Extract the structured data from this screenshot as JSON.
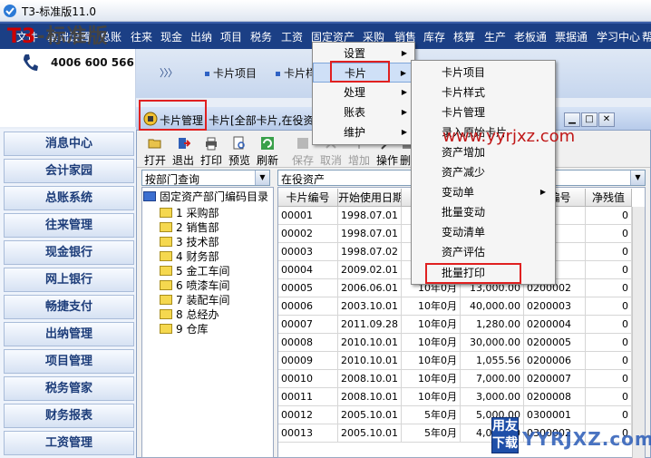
{
  "app": {
    "title": "T3-标准版11.0"
  },
  "menubar": {
    "items": [
      "文件",
      "基础设置",
      "总账",
      "往来",
      "现金",
      "出纳",
      "项目",
      "税务",
      "工资",
      "固定资产",
      "采购",
      "销售",
      "库存",
      "核算",
      "生产",
      "老板通",
      "票据通",
      "学习中心",
      "帮"
    ]
  },
  "logo": {
    "t3": "T3",
    "rest": "-标准版",
    "phone": "4006 600 566"
  },
  "sidebar": {
    "items": [
      "消息中心",
      "会计家园",
      "总账系统",
      "往来管理",
      "现金银行",
      "网上银行",
      "畅捷支付",
      "出纳管理",
      "项目管理",
      "税务管家",
      "财务报表",
      "工资管理"
    ]
  },
  "tabs": {
    "arrows": "〉〉〉",
    "items": [
      "卡片项目",
      "卡片样式"
    ]
  },
  "child": {
    "title": "卡片管理",
    "subtitle": "卡片[全部卡片,在役资产]"
  },
  "toolbar": {
    "items": [
      "打开",
      "退出",
      "打印",
      "预览",
      "刷新",
      "保存",
      "取消",
      "增加",
      "操作",
      "删"
    ]
  },
  "left_combo": {
    "value": "按部门查询"
  },
  "right_combo": {
    "value": "在役资产"
  },
  "tree": {
    "root": "固定资产部门编码目录",
    "items": [
      "1 采购部",
      "2 销售部",
      "3 技术部",
      "4 财务部",
      "5 金工车间",
      "6 喷漆车间",
      "7 装配车间",
      "8 总经办",
      "9 仓库"
    ]
  },
  "grid": {
    "headers": [
      "卡片编号",
      "开始使用日期",
      "",
      "",
      "产编号",
      "净残值"
    ],
    "rows": [
      [
        "00001",
        "1998.07.01",
        "",
        "",
        "01",
        "0"
      ],
      [
        "00002",
        "1998.07.01",
        "",
        "",
        "02",
        "0"
      ],
      [
        "00003",
        "1998.07.02",
        "",
        "",
        "03",
        "0"
      ],
      [
        "00004",
        "2009.02.01",
        "",
        "",
        "01",
        "0"
      ],
      [
        "00005",
        "2006.06.01",
        "10年0月",
        "13,000.00",
        "0200002",
        "0"
      ],
      [
        "00006",
        "2003.10.01",
        "10年0月",
        "40,000.00",
        "0200003",
        "0"
      ],
      [
        "00007",
        "2011.09.28",
        "10年0月",
        "1,280.00",
        "0200004",
        "0"
      ],
      [
        "00008",
        "2010.10.01",
        "10年0月",
        "30,000.00",
        "0200005",
        "0"
      ],
      [
        "00009",
        "2010.10.01",
        "10年0月",
        "1,055.56",
        "0200006",
        "0"
      ],
      [
        "00010",
        "2008.10.01",
        "10年0月",
        "7,000.00",
        "0200007",
        "0"
      ],
      [
        "00011",
        "2008.10.01",
        "10年0月",
        "3,000.00",
        "0200008",
        "0"
      ],
      [
        "00012",
        "2005.10.01",
        "5年0月",
        "5,000.00",
        "0300001",
        "0"
      ],
      [
        "00013",
        "2005.10.01",
        "5年0月",
        "4,000.00",
        "0300002",
        "0"
      ]
    ]
  },
  "menu_fixed_assets": {
    "items": [
      "设置",
      "卡片",
      "处理",
      "账表",
      "维护"
    ]
  },
  "menu_card": {
    "items": [
      "卡片项目",
      "卡片样式",
      "卡片管理",
      "录入原始卡片",
      "资产增加",
      "资产减少",
      "变动单",
      "批量变动",
      "变动清单",
      "资产评估",
      "批量打印"
    ]
  },
  "watermark": {
    "url": "www.yyrjxz.com",
    "box_text": "用友下载",
    "brand": "YYRJXZ.com"
  },
  "colors": {
    "menubar": "#1b3f85",
    "highlight": "#e02020",
    "sidebar_text": "#1d3d7a"
  }
}
